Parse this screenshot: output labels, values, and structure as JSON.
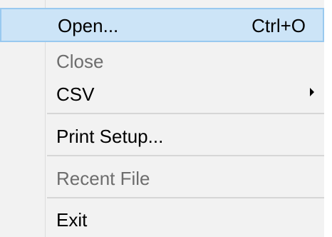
{
  "menu": {
    "items": [
      {
        "label": "Open...",
        "shortcut": "Ctrl+O",
        "state": "highlighted"
      },
      {
        "label": "Close",
        "state": "disabled"
      },
      {
        "label": "CSV",
        "state": "enabled",
        "submenu": true
      },
      {
        "label": "Print Setup...",
        "state": "enabled"
      },
      {
        "label": "Recent File",
        "state": "disabled"
      },
      {
        "label": "Exit",
        "state": "enabled"
      }
    ]
  },
  "colors": {
    "menu_background": "#f2f2f2",
    "highlight_fill": "#cce4f7",
    "highlight_border": "#99c9ef",
    "disabled_text": "#6d6d6d",
    "separator": "#d6d6d6"
  }
}
